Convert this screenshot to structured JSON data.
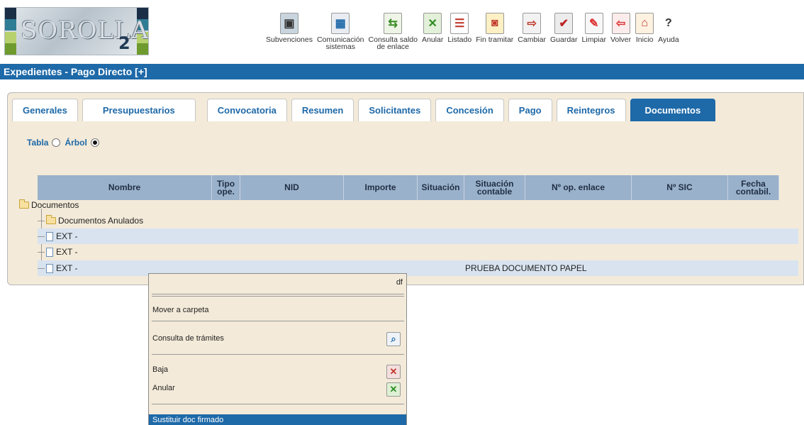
{
  "header": {
    "logo_text": "SOROLLA",
    "logo_sub": "2",
    "toolbar": [
      {
        "label": "Subvenciones",
        "icon": "briefcase-icon"
      },
      {
        "label": "Comunicación\nsistemas",
        "icon": "computers-icon"
      },
      {
        "label": "Consulta saldo\nde enlace",
        "icon": "arrows-icon"
      },
      {
        "label": "Anular",
        "icon": "x-icon"
      },
      {
        "label": "Listado",
        "icon": "list-icon"
      },
      {
        "label": "Fin tramitar",
        "icon": "lock-icon"
      },
      {
        "label": "Cambiar",
        "icon": "change-icon"
      },
      {
        "label": "Guardar",
        "icon": "save-icon"
      },
      {
        "label": "Limpiar",
        "icon": "eraser-icon"
      },
      {
        "label": "Volver",
        "icon": "back-icon"
      },
      {
        "label": "Inicio",
        "icon": "home-icon"
      },
      {
        "label": "Ayuda",
        "icon": "help-icon"
      }
    ]
  },
  "page_title": "Expedientes - Pago Directo [+]",
  "tabs": [
    {
      "label": "Generales"
    },
    {
      "label": "Presupuestarios"
    },
    {
      "label": "Convocatoria"
    },
    {
      "label": "Resumen"
    },
    {
      "label": "Solicitantes"
    },
    {
      "label": "Concesión"
    },
    {
      "label": "Pago"
    },
    {
      "label": "Reintegros"
    },
    {
      "label": "Documentos",
      "active": true
    }
  ],
  "view_selector": {
    "tabla": "Tabla",
    "arbol": "Árbol",
    "selected": "Árbol"
  },
  "table": {
    "columns": [
      "Nombre",
      "Tipo ope.",
      "NID",
      "Importe",
      "Situación",
      "Situación contable",
      "Nº op. enlace",
      "Nº SIC",
      "Fecha contabil."
    ],
    "rows": [
      {
        "label": "Documentos",
        "type": "folder"
      },
      {
        "label": "Documentos Anulados",
        "type": "folder"
      },
      {
        "label": "EXT -",
        "type": "doc"
      },
      {
        "label": "EXT -",
        "type": "doc"
      },
      {
        "label": "EXT -",
        "type": "doc",
        "description": "PRUEBA DOCUMENTO PAPEL"
      }
    ]
  },
  "context_menu": {
    "top_right_text": "df",
    "items": [
      {
        "label": "Mover a carpeta"
      },
      {
        "label": "Consulta de trámites",
        "icon": "search-doc-icon"
      },
      {
        "label": "Baja",
        "icon": "x-icon"
      },
      {
        "label": "Anular",
        "icon": "x-icon"
      },
      {
        "label": "Sustituir doc firmado",
        "highlighted": true
      }
    ]
  }
}
